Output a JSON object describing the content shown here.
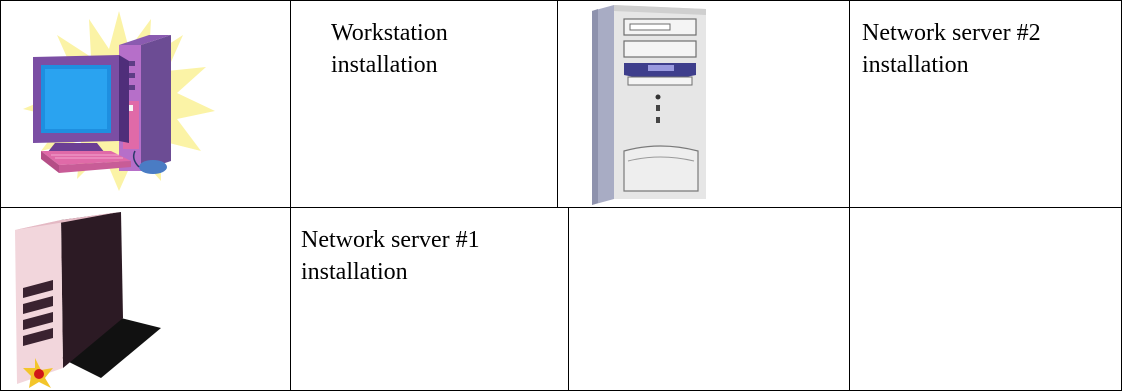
{
  "table": {
    "rows": [
      {
        "cells": [
          {
            "kind": "image",
            "icon": "workstation-computer-icon"
          },
          {
            "kind": "text",
            "text": "Workstation\ninstallation"
          },
          {
            "kind": "image",
            "icon": "tower-server-icon"
          },
          {
            "kind": "text",
            "text": "Network server #2\ninstallation"
          }
        ]
      },
      {
        "cells": [
          {
            "kind": "image",
            "icon": "pink-server-icon"
          },
          {
            "kind": "text",
            "text": "Network server #1\ninstallation"
          },
          {
            "kind": "empty"
          },
          {
            "kind": "empty"
          }
        ]
      }
    ]
  }
}
